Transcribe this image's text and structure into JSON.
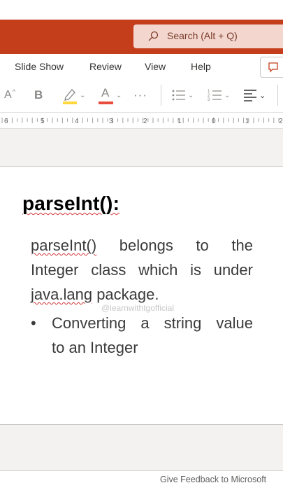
{
  "search": {
    "placeholder": "Search (Alt + Q)"
  },
  "menu": {
    "tabs": [
      "Slide Show",
      "Review",
      "View",
      "Help"
    ]
  },
  "toolbar": {
    "grow_font_label": "A",
    "bold_label": "B",
    "font_color_label": "A",
    "more_label": "···"
  },
  "ruler": {
    "labels": [
      "6",
      "5",
      "4",
      "3",
      "2",
      "1",
      "0",
      "1",
      "2"
    ]
  },
  "slide": {
    "heading": "parseInt():",
    "paragraph_line1_words": [
      "parseInt()",
      "belongs",
      "to",
      "the"
    ],
    "paragraph_line2_words": [
      "Integer",
      "class",
      "which",
      "is",
      "under"
    ],
    "paragraph_line3_a": "java.lang",
    "paragraph_line3_b": " package.",
    "bullet_symbol": "•",
    "bullet_line1_words": [
      "Converting",
      "a",
      "string",
      "value"
    ],
    "bullet_line2": "to an Integer"
  },
  "watermark": "@learnwithtgofficial",
  "statusbar": {
    "feedback": "Give Feedback to Microsoft"
  },
  "colors": {
    "titlebar": "#c43e1c",
    "search_bg": "#f3d7cf",
    "highlight_yellow": "#ffd83d",
    "font_red": "#e74c3c"
  }
}
